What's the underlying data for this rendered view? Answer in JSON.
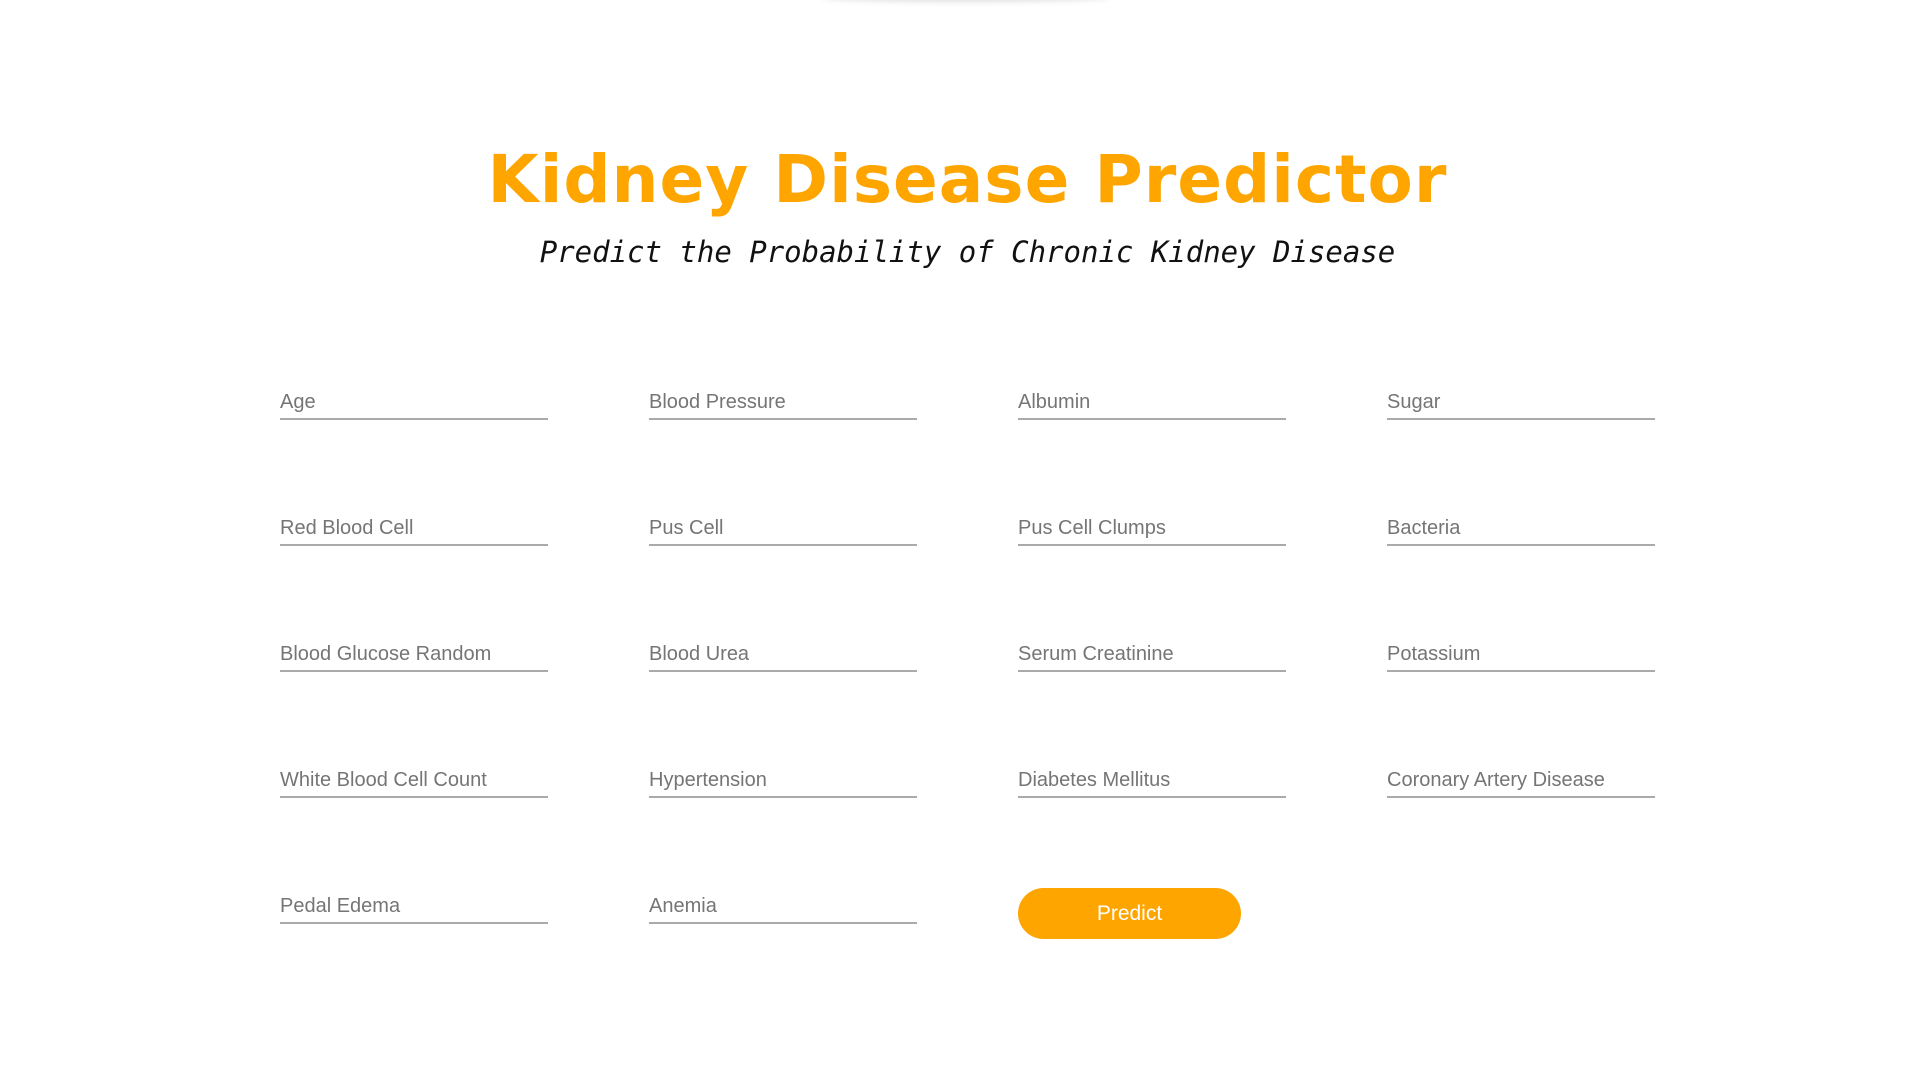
{
  "header": {
    "title": "Kidney Disease Predictor",
    "subtitle": "Predict the Probability of Chronic Kidney Disease"
  },
  "form": {
    "fields": [
      {
        "placeholder": "Age",
        "value": ""
      },
      {
        "placeholder": "Blood Pressure",
        "value": ""
      },
      {
        "placeholder": "Albumin",
        "value": ""
      },
      {
        "placeholder": "Sugar",
        "value": ""
      },
      {
        "placeholder": "Red Blood Cell",
        "value": ""
      },
      {
        "placeholder": "Pus Cell",
        "value": ""
      },
      {
        "placeholder": "Pus Cell Clumps",
        "value": ""
      },
      {
        "placeholder": "Bacteria",
        "value": ""
      },
      {
        "placeholder": "Blood Glucose Random",
        "value": ""
      },
      {
        "placeholder": "Blood Urea",
        "value": ""
      },
      {
        "placeholder": "Serum Creatinine",
        "value": ""
      },
      {
        "placeholder": "Potassium",
        "value": ""
      },
      {
        "placeholder": "White Blood Cell Count",
        "value": ""
      },
      {
        "placeholder": "Hypertension",
        "value": ""
      },
      {
        "placeholder": "Diabetes Mellitus",
        "value": ""
      },
      {
        "placeholder": "Coronary Artery Disease",
        "value": ""
      },
      {
        "placeholder": "Pedal Edema",
        "value": ""
      },
      {
        "placeholder": "Anemia",
        "value": ""
      }
    ],
    "submit_label": "Predict"
  },
  "colors": {
    "accent": "#FFA500",
    "text": "#111111",
    "placeholder": "#757575",
    "underline": "#aaaaaa"
  }
}
